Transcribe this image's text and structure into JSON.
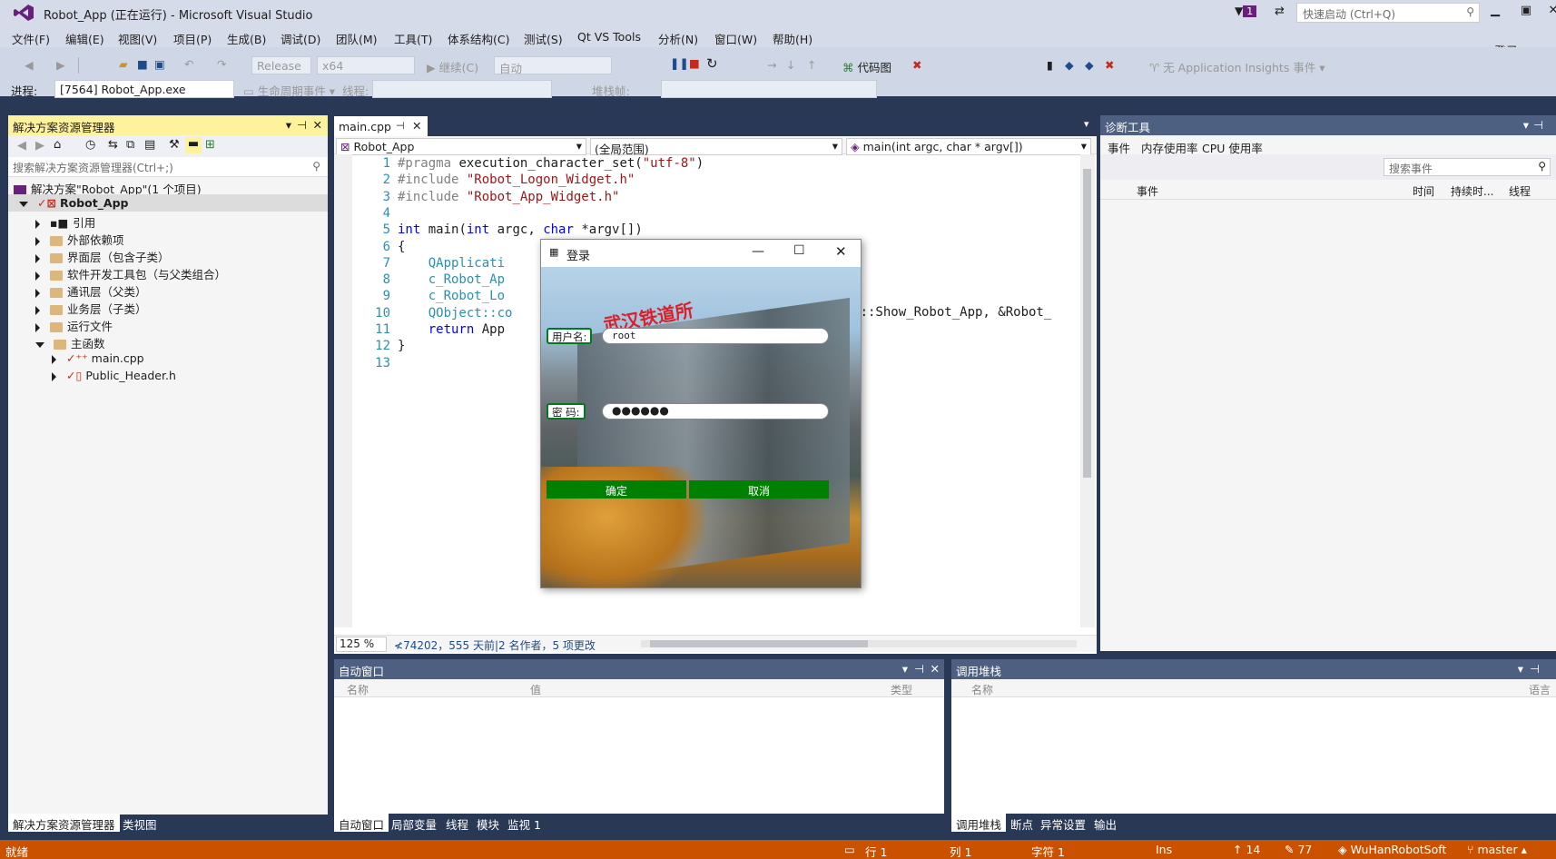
{
  "window": {
    "title": "Robot_App (正在运行) - Microsoft Visual Studio",
    "notification_count": "1",
    "quick_launch_placeholder": "快速启动 (Ctrl+Q)",
    "sign_in": "登录"
  },
  "menu": [
    "文件(F)",
    "编辑(E)",
    "视图(V)",
    "项目(P)",
    "生成(B)",
    "调试(D)",
    "团队(M)",
    "工具(T)",
    "体系结构(C)",
    "测试(S)",
    "Qt VS Tools",
    "分析(N)",
    "窗口(W)",
    "帮助(H)"
  ],
  "toolbar": {
    "config": "Release",
    "platform": "x64",
    "continue": "继续(C)",
    "auto": "自动",
    "codemap": "代码图",
    "insights": "无 Application Insights 事件",
    "process_label": "进程:",
    "process": "[7564] Robot_App.exe",
    "lifecycle": "生命周期事件",
    "thread_label": "线程:",
    "stackframe_label": "堆栈帧:"
  },
  "solution_explorer": {
    "title": "解决方案资源管理器",
    "search_placeholder": "搜索解决方案资源管理器(Ctrl+;)",
    "solution": "解决方案\"Robot_App\"(1 个项目)",
    "project": "Robot_App",
    "items": [
      "引用",
      "外部依赖项",
      "界面层（包含子类）",
      "软件开发工具包（与父类组合）",
      "通讯层（父类）",
      "业务层（子类）",
      "运行文件",
      "主函数"
    ],
    "files": [
      "main.cpp",
      "Public_Header.h"
    ],
    "tabs": [
      "解决方案资源管理器",
      "类视图"
    ]
  },
  "editor": {
    "tab": "main.cpp",
    "nav_project": "Robot_App",
    "nav_scope": "(全局范围)",
    "nav_member": "main(int argc, char * argv[])",
    "zoom": "125 %",
    "codelens": "74202，555 天前|2 名作者，5 项更改",
    "lines": [
      {
        "n": "1",
        "text": "#pragma execution_character_set(\"utf-8\")"
      },
      {
        "n": "2",
        "text": "#include \"Robot_Logon_Widget.h\""
      },
      {
        "n": "3",
        "text": "#include \"Robot_App_Widget.h\""
      },
      {
        "n": "4",
        "text": ""
      },
      {
        "n": "5",
        "text": "int main(int argc, char *argv[])"
      },
      {
        "n": "6",
        "text": "{"
      },
      {
        "n": "7",
        "text": "    QApplicati"
      },
      {
        "n": "8",
        "text": "    c_Robot_Ap"
      },
      {
        "n": "9",
        "text": "    c_Robot_Lo"
      },
      {
        "n": "10",
        "text": "    QObject::co"
      },
      {
        "n": "11",
        "text": "    return App"
      },
      {
        "n": "12",
        "text": "}"
      },
      {
        "n": "13",
        "text": ""
      }
    ],
    "line10_tail": "Widget::Show_Robot_App, &Robot_"
  },
  "login_dialog": {
    "title": "登录",
    "username_label": "用户名:",
    "username": "root",
    "password_label": "密  码:",
    "password_mask": "●●●●●●",
    "building_sign": "武汉铁道所",
    "ok": "确定",
    "cancel": "取消"
  },
  "diagnostics": {
    "title": "诊断工具",
    "tabs": [
      "事件",
      "内存使用率",
      "CPU 使用率"
    ],
    "search_placeholder": "搜索事件",
    "columns": [
      "事件",
      "时间",
      "持续时...",
      "线程"
    ]
  },
  "autos": {
    "title": "自动窗口",
    "columns": [
      "名称",
      "值",
      "类型"
    ],
    "tabs": [
      "自动窗口",
      "局部变量",
      "线程",
      "模块",
      "监视 1"
    ]
  },
  "callstack": {
    "title": "调用堆栈",
    "columns": [
      "名称",
      "语言"
    ],
    "tabs": [
      "调用堆栈",
      "断点",
      "异常设置",
      "输出"
    ]
  },
  "status": {
    "ready": "就绪",
    "line": "行 1",
    "col": "列 1",
    "char": "字符 1",
    "ins": "Ins",
    "push": "14",
    "edits": "77",
    "repo": "WuHanRobotSoft",
    "branch": "master"
  }
}
